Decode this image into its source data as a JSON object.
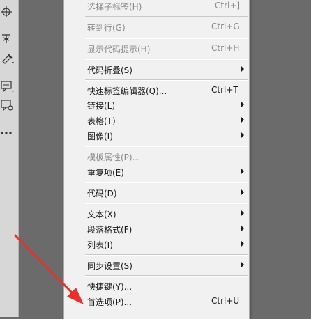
{
  "menu": {
    "items": [
      {
        "label": "选择子标签(H)",
        "shortcut": "Ctrl+]",
        "disabled": true,
        "submenu": false
      },
      {
        "label": "转到行(G)",
        "shortcut": "Ctrl+G",
        "disabled": true,
        "submenu": false
      },
      {
        "label": "显示代码提示(H)",
        "shortcut": "Ctrl+H",
        "disabled": true,
        "submenu": false
      },
      {
        "label": "代码折叠(S)",
        "shortcut": "",
        "disabled": false,
        "submenu": true
      },
      {
        "label": "快速标签编辑器(Q)...",
        "shortcut": "Ctrl+T",
        "disabled": false,
        "submenu": false
      },
      {
        "label": "链接(L)",
        "shortcut": "",
        "disabled": false,
        "submenu": true
      },
      {
        "label": "表格(T)",
        "shortcut": "",
        "disabled": false,
        "submenu": true
      },
      {
        "label": "图像(I)",
        "shortcut": "",
        "disabled": false,
        "submenu": true
      },
      {
        "label": "模板属性(P)...",
        "shortcut": "",
        "disabled": true,
        "submenu": false
      },
      {
        "label": "重复项(E)",
        "shortcut": "",
        "disabled": false,
        "submenu": true
      },
      {
        "label": "代码(D)",
        "shortcut": "",
        "disabled": false,
        "submenu": true
      },
      {
        "label": "文本(X)",
        "shortcut": "",
        "disabled": false,
        "submenu": true
      },
      {
        "label": "段落格式(F)",
        "shortcut": "",
        "disabled": false,
        "submenu": true
      },
      {
        "label": "列表(I)",
        "shortcut": "",
        "disabled": false,
        "submenu": true
      },
      {
        "label": "同步设置(S)",
        "shortcut": "",
        "disabled": false,
        "submenu": true
      },
      {
        "label": "快捷键(Y)...",
        "shortcut": "",
        "disabled": false,
        "submenu": false
      },
      {
        "label": "首选项(P)...",
        "shortcut": "Ctrl+U",
        "disabled": false,
        "submenu": false
      }
    ]
  },
  "toolbar": {
    "icons": [
      "crosshair-icon",
      "scissors-icon",
      "eyedropper-icon",
      "comment-icon",
      "comment-settings-icon",
      "more-icon"
    ]
  },
  "colors": {
    "background": "#6b6b6b",
    "menu_bg": "#f1f1f1",
    "toolbar_bg": "#d7d7d7",
    "disabled_text": "#8a8a8a",
    "annotation_arrow": "#e8312a"
  }
}
